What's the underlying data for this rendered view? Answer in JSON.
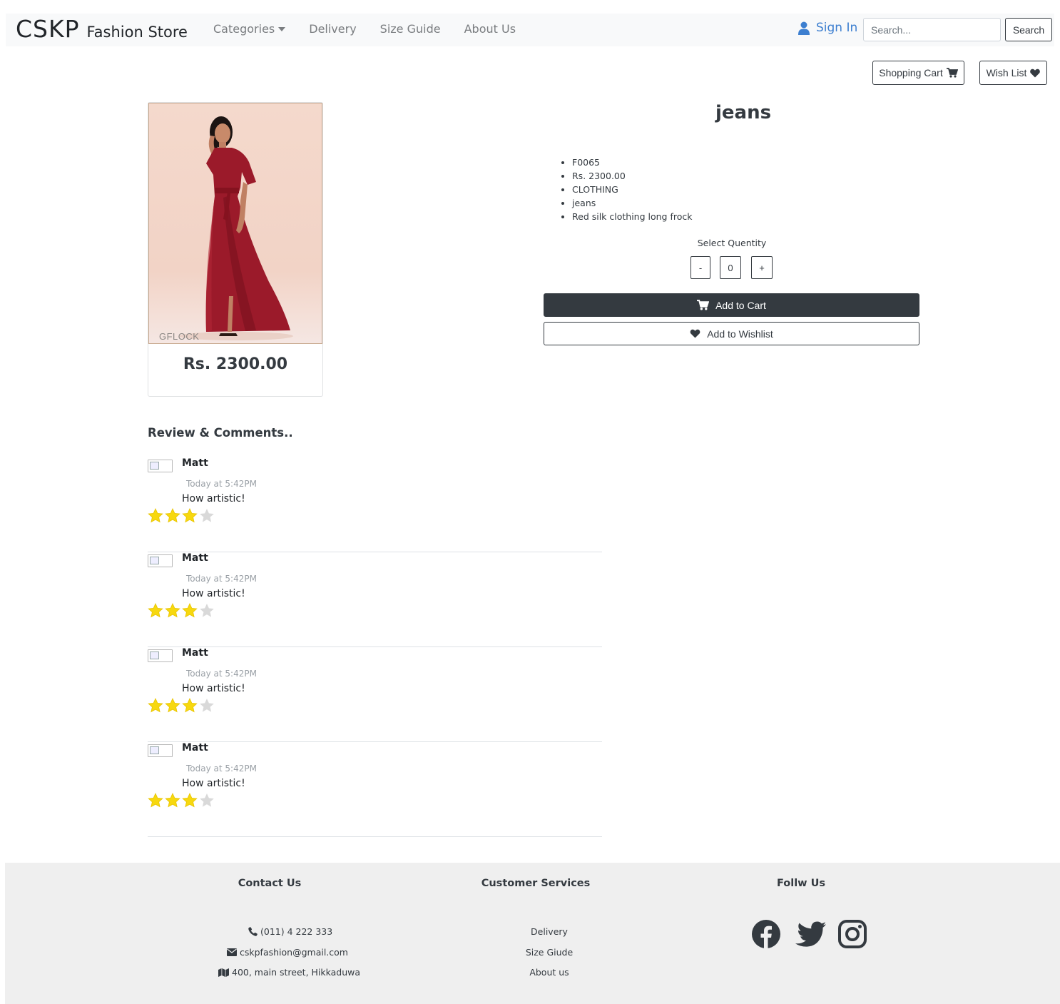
{
  "nav": {
    "brand_main": "CSKP",
    "brand_sub": "Fashion Store",
    "links": [
      "Categories",
      "Delivery",
      "Size Guide",
      "About Us"
    ],
    "sign_in": "Sign In",
    "search_placeholder": "Search...",
    "search_button": "Search"
  },
  "actions": {
    "shopping_cart": "Shopping Cart",
    "wish_list": "Wish List"
  },
  "product": {
    "image_watermark": "GFLOCK",
    "card_price": "Rs. 2300.00",
    "title": "jeans",
    "details": [
      "F0065",
      "Rs. 2300.00",
      "CLOTHING",
      "jeans",
      "Red silk clothing long frock"
    ],
    "quantity_label": "Select Quentity",
    "quantity_minus": "-",
    "quantity_value": "0",
    "quantity_plus": "+",
    "add_to_cart": "Add to Cart",
    "add_to_wishlist": "Add to Wishlist"
  },
  "reviews": {
    "title": "Review & Comments..",
    "items": [
      {
        "name": "Matt",
        "time": "Today at 5:42PM",
        "text": "How artistic!",
        "rating": 3,
        "max_rating": 4
      },
      {
        "name": "Matt",
        "time": "Today at 5:42PM",
        "text": "How artistic!",
        "rating": 3,
        "max_rating": 4
      },
      {
        "name": "Matt",
        "time": "Today at 5:42PM",
        "text": "How artistic!",
        "rating": 3,
        "max_rating": 4
      },
      {
        "name": "Matt",
        "time": "Today at 5:42PM",
        "text": "How artistic!",
        "rating": 3,
        "max_rating": 4
      }
    ]
  },
  "footer": {
    "contact_title": "Contact Us",
    "phone": "(011) 4 222 333",
    "email": "cskpfashion@gmail.com",
    "address": "400, main street, Hikkaduwa",
    "services_title": "Customer Services",
    "services": [
      "Delivery",
      "Size Giude",
      "About us"
    ],
    "follow_title": "Follw Us",
    "social_icons": [
      "facebook-icon",
      "twitter-icon",
      "instagram-icon"
    ]
  },
  "colors": {
    "primary_dark": "#343a40",
    "sign_in_blue": "#3d7fd0",
    "star_filled": "#f7d80f",
    "star_empty": "#d9d9d9",
    "dress_red": "#9b1a2a"
  }
}
